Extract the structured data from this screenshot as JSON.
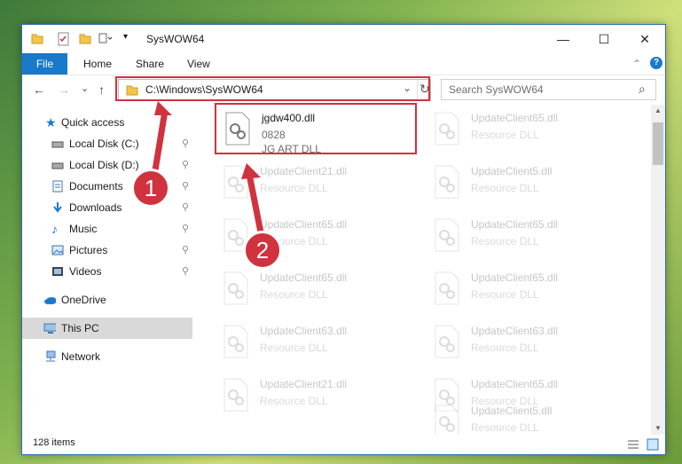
{
  "window": {
    "title": "SysWOW64",
    "minimize_glyph": "—",
    "maximize_glyph": "☐",
    "close_glyph": "✕"
  },
  "ribbon": {
    "tabs": [
      "File",
      "Home",
      "Share",
      "View"
    ],
    "collapse_glyph": "⌃",
    "help_glyph": "?"
  },
  "address": {
    "path": "C:\\Windows\\SysWOW64",
    "dropdown_glyph": "⌄",
    "refresh_glyph": "↻"
  },
  "search": {
    "placeholder": "Search SysWOW64",
    "icon_glyph": "⌕"
  },
  "nav": {
    "back_glyph": "←",
    "forward_glyph": "→",
    "recent_glyph": "⌄",
    "up_glyph": "↑"
  },
  "sidebar": {
    "quick_access": "Quick access",
    "items": [
      {
        "label": "Local Disk (C:)",
        "icon": "drive-icon"
      },
      {
        "label": "Local Disk (D:)",
        "icon": "drive-icon"
      },
      {
        "label": "Documents",
        "icon": "documents-icon"
      },
      {
        "label": "Downloads",
        "icon": "downloads-icon"
      },
      {
        "label": "Music",
        "icon": "music-icon"
      },
      {
        "label": "Pictures",
        "icon": "pictures-icon"
      },
      {
        "label": "Videos",
        "icon": "videos-icon"
      }
    ],
    "pin_glyph": "📌",
    "onedrive": "OneDrive",
    "this_pc": "This PC",
    "network": "Network"
  },
  "files": {
    "highlighted": {
      "name": "jgdw400.dll",
      "version": "0828",
      "description": "JG ART DLL"
    },
    "left": [
      {
        "name": "UpdateClient21.dll",
        "type": "Resource DLL"
      },
      {
        "name": "UpdateClient65.dll",
        "type": "Resource DLL"
      },
      {
        "name": "UpdateClient65.dll",
        "type": "Resource DLL"
      },
      {
        "name": "UpdateClient63.dll",
        "type": "Resource DLL"
      },
      {
        "name": "UpdateClient21.dll",
        "type": "Resource DLL"
      }
    ],
    "right": [
      {
        "name": "UpdateClient65.dll",
        "type": "Resource DLL"
      },
      {
        "name": "UpdateClient5.dll",
        "type": "Resource DLL"
      },
      {
        "name": "UpdateClient65.dll",
        "type": "Resource DLL"
      },
      {
        "name": "UpdateClient65.dll",
        "type": "Resource DLL"
      },
      {
        "name": "UpdateClient63.dll",
        "type": "Resource DLL"
      },
      {
        "name": "UpdateClient65.dll",
        "type": "Resource DLL"
      },
      {
        "name": "UpdateClient5.dll",
        "type": "Resource DLL"
      }
    ]
  },
  "status": {
    "item_count": "128 items"
  },
  "callouts": {
    "first": "1",
    "second": "2"
  },
  "colors": {
    "accent": "#1979ca",
    "highlight_red": "#d0323e",
    "selection": "#cce8ff"
  }
}
